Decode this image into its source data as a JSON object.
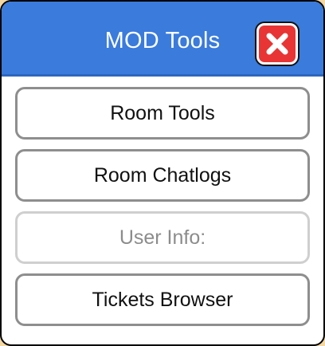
{
  "window": {
    "title": "MOD Tools",
    "close_icon": "close-icon"
  },
  "colors": {
    "titlebar": "#3a7bdc",
    "close_button": "#e83434",
    "page_background": "#f3d8a4"
  },
  "menu": {
    "items": [
      {
        "label": "Room Tools",
        "enabled": true
      },
      {
        "label": "Room Chatlogs",
        "enabled": true
      },
      {
        "label": "User Info:",
        "enabled": false
      },
      {
        "label": "Tickets Browser",
        "enabled": true
      }
    ]
  }
}
